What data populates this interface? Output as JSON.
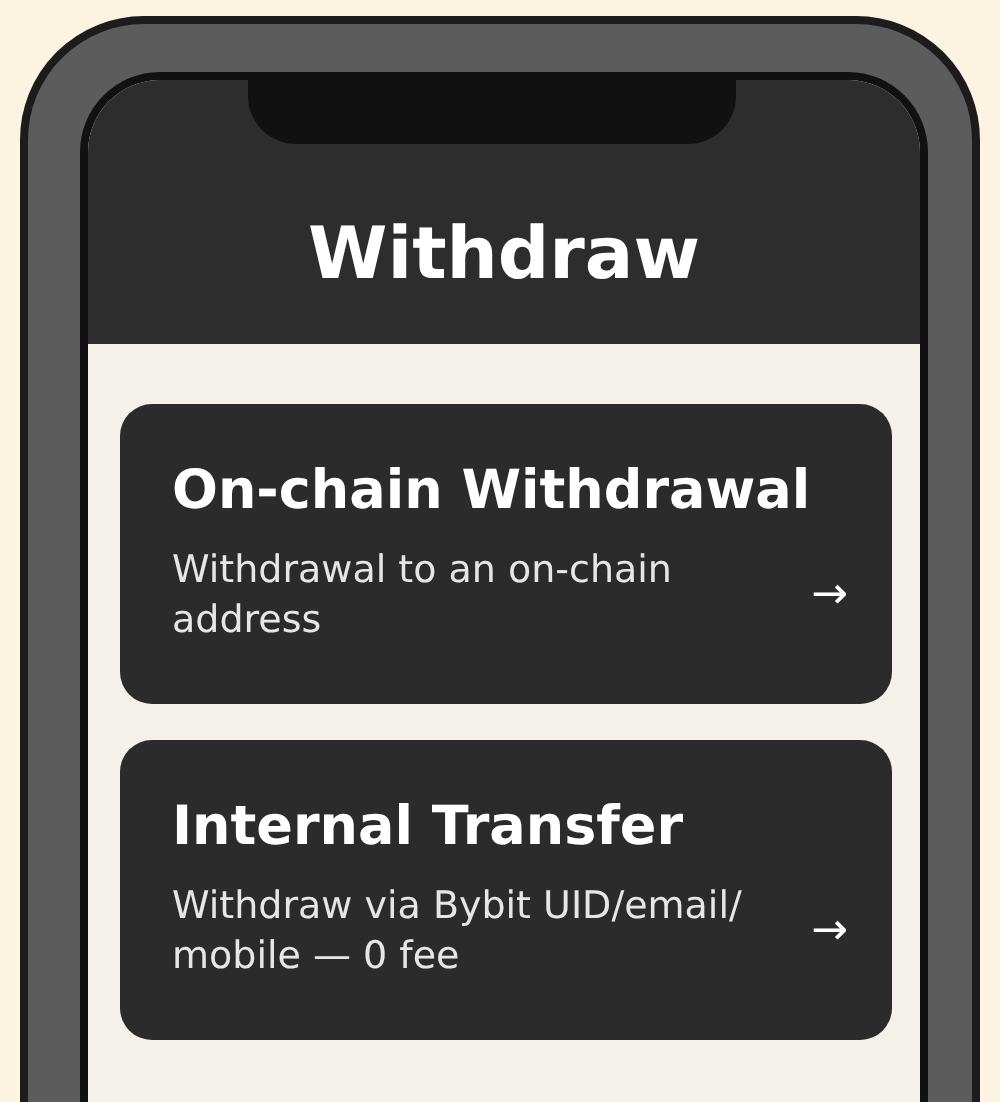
{
  "screen": {
    "title": "Withdraw"
  },
  "options": [
    {
      "title": "On-chain Withdrawal",
      "description": "Withdrawal to an on-chain address",
      "arrow": "→"
    },
    {
      "title": "Internal Transfer",
      "description": "Withdraw via Bybit UID/email/ mobile — 0 fee",
      "arrow": "→"
    }
  ]
}
